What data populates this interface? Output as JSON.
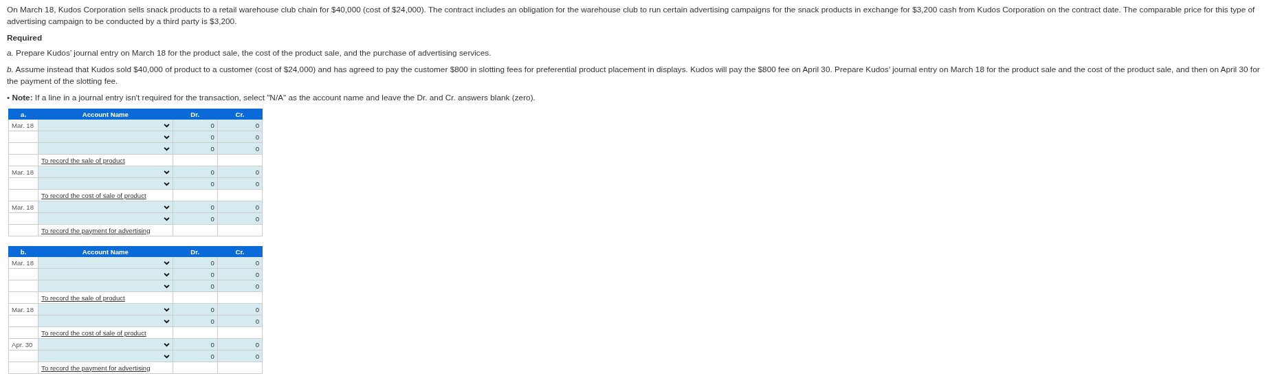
{
  "intro": "On March 18, Kudos Corporation sells snack products to a retail warehouse club chain for $40,000 (cost of $24,000). The contract includes an obligation for the warehouse club to run certain advertising campaigns for the snack products in exchange for $3,200 cash from Kudos Corporation on the contract date. The comparable price for this type of advertising campaign to be conducted by a third party is $3,200.",
  "required_heading": "Required",
  "requirements": [
    {
      "label": "a.",
      "text": "Prepare Kudos’ journal entry on March 18 for the product sale, the cost of the product sale, and the purchase of advertising services."
    },
    {
      "label": "b.",
      "text": "Assume instead that Kudos sold $40,000 of product to a customer (cost of $24,000) and has agreed to pay the customer $800 in slotting fees for preferential product placement in displays. Kudos will pay the $800 fee on April 30. Prepare Kudos’ journal entry on March 18 for the product sale and the cost of the product sale, and then on April 30 for the payment of the slotting fee."
    }
  ],
  "note": {
    "bullet": "•",
    "label": "Note:",
    "text": "If a line in a journal entry isn't required for the transaction, select \"N/A\" as the account name and leave the Dr. and Cr. answers blank (zero)."
  },
  "tables": [
    {
      "label": "a.",
      "columns": [
        "Account Name",
        "Dr.",
        "Cr."
      ],
      "entries": [
        {
          "date": "Mar. 18",
          "lines": [
            {
              "dr": "0",
              "cr": "0"
            },
            {
              "dr": "0",
              "cr": "0"
            },
            {
              "dr": "0",
              "cr": "0"
            }
          ],
          "memo": "To record the sale of product"
        },
        {
          "date": "Mar. 18",
          "lines": [
            {
              "dr": "0",
              "cr": "0"
            },
            {
              "dr": "0",
              "cr": "0"
            }
          ],
          "memo": "To record the cost of sale of product"
        },
        {
          "date": "Mar. 18",
          "lines": [
            {
              "dr": "0",
              "cr": "0"
            },
            {
              "dr": "0",
              "cr": "0"
            }
          ],
          "memo": "To record the payment for advertising"
        }
      ]
    },
    {
      "label": "b.",
      "columns": [
        "Account Name",
        "Dr.",
        "Cr."
      ],
      "entries": [
        {
          "date": "Mar. 18",
          "lines": [
            {
              "dr": "0",
              "cr": "0"
            },
            {
              "dr": "0",
              "cr": "0"
            },
            {
              "dr": "0",
              "cr": "0"
            }
          ],
          "memo": "To record the sale of product"
        },
        {
          "date": "Mar. 18",
          "lines": [
            {
              "dr": "0",
              "cr": "0"
            },
            {
              "dr": "0",
              "cr": "0"
            }
          ],
          "memo": "To record the cost of sale of product"
        },
        {
          "date": "Apr. 30",
          "lines": [
            {
              "dr": "0",
              "cr": "0"
            },
            {
              "dr": "0",
              "cr": "0"
            }
          ],
          "memo": "To record the payment for advertising"
        }
      ]
    }
  ]
}
